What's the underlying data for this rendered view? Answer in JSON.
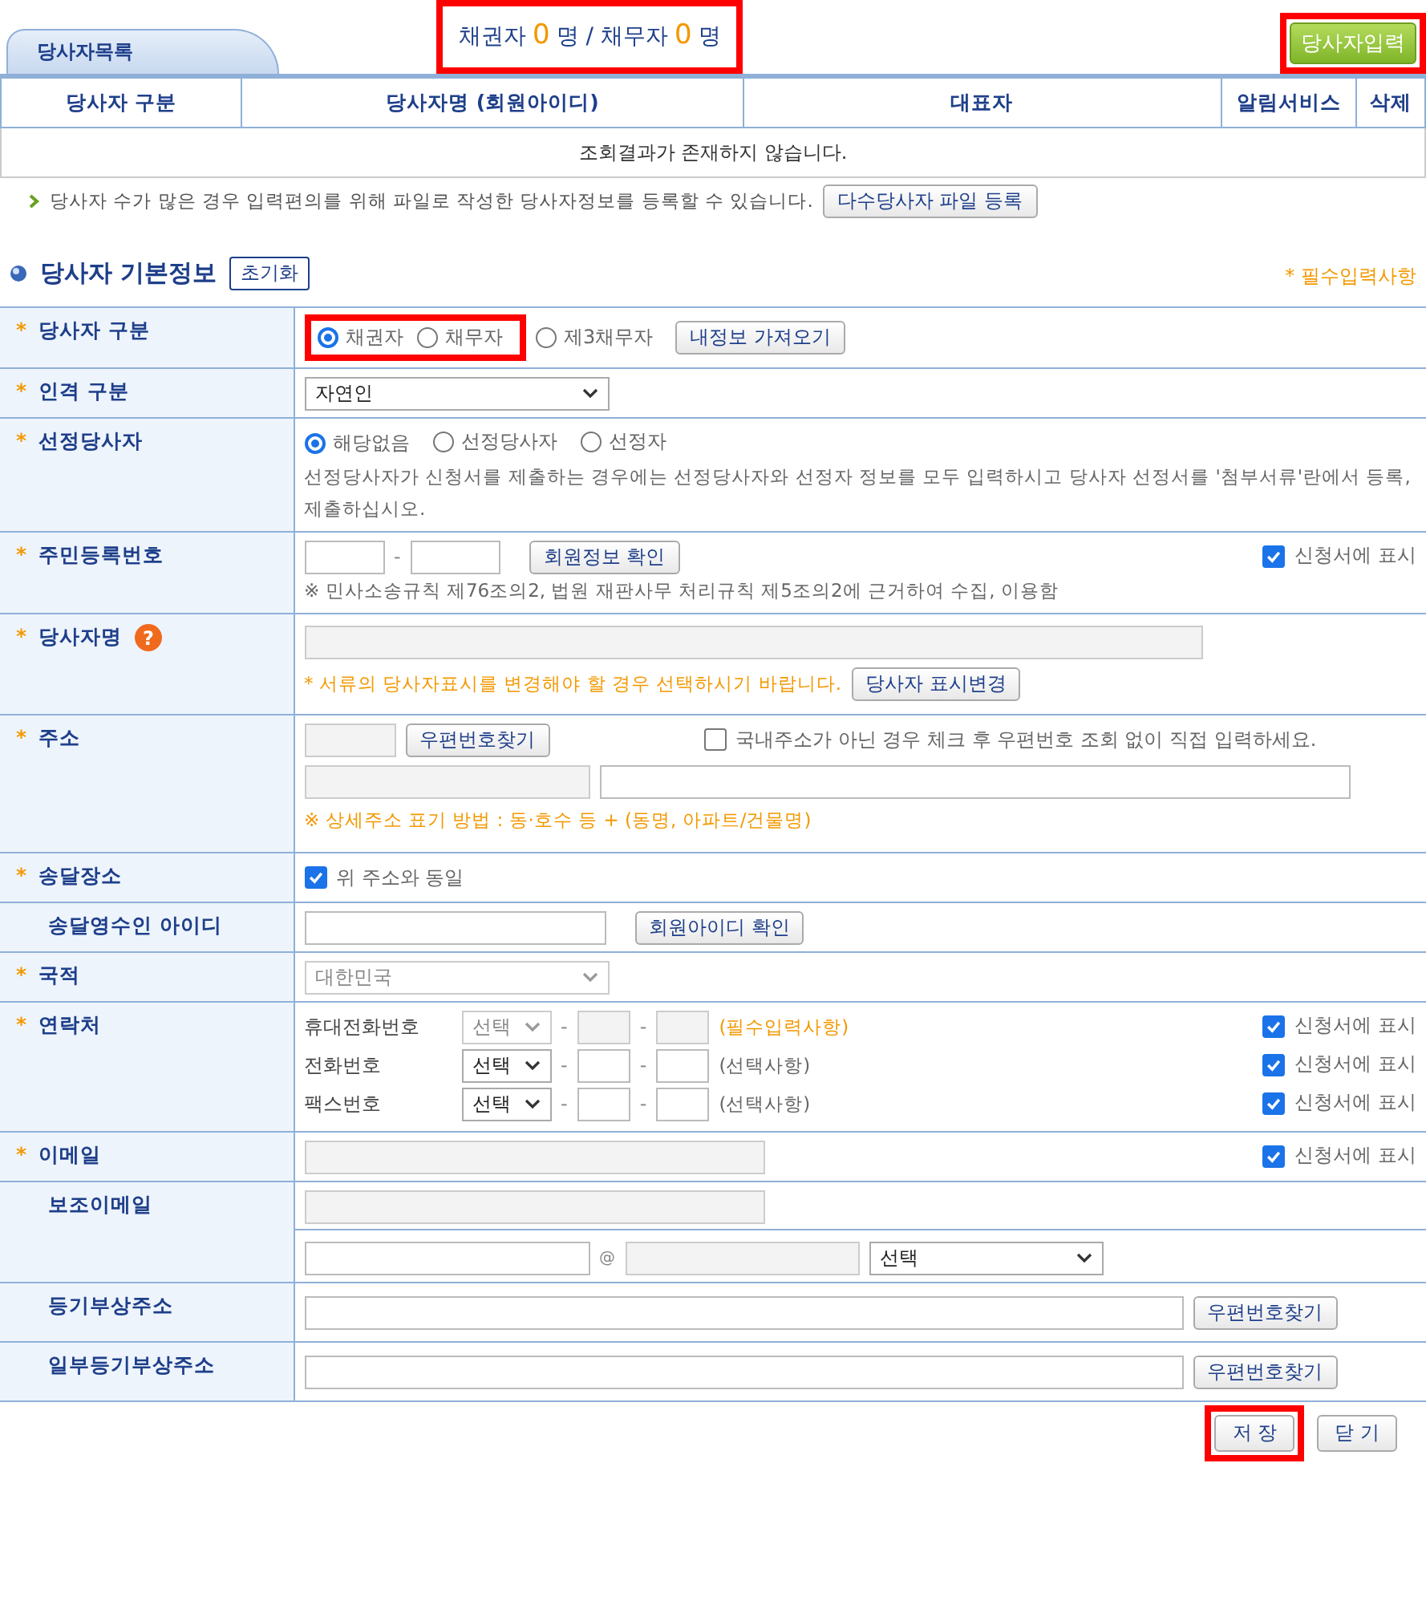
{
  "list_panel": {
    "tab": "당사자목록",
    "counter": {
      "highlighted": true,
      "creditor_label": "채권자",
      "creditor_count": "0",
      "creditor_unit": "명",
      "separator": "/",
      "debtor_label": "채무자",
      "debtor_count": "0",
      "debtor_unit": "명"
    },
    "add_button": {
      "label": "당사자입력",
      "highlighted": true
    },
    "columns": [
      "당사자 구분",
      "당사자명 (회원아이디)",
      "대표자",
      "알림서비스",
      "삭제"
    ],
    "empty_message": "조회결과가 존재하지 않습니다.",
    "bulk_note": "당사자 수가 많은 경우 입력편의를 위해 파일로 작성한 당사자정보를 등록할 수 있습니다.",
    "bulk_button": "다수당사자 파일 등록"
  },
  "section": {
    "title": "당사자 기본정보",
    "reset_button": "초기화",
    "required_note": "* 필수입력사항"
  },
  "rows": [
    {
      "kind": "radio",
      "label": "당사자 구분",
      "mark": "*",
      "options": [
        {
          "label": "채권자",
          "selected": true,
          "highlighted": true
        },
        {
          "label": "채무자",
          "selected": false,
          "highlighted": true
        },
        {
          "label": "제3채무자",
          "selected": false,
          "highlighted": false
        }
      ],
      "button": "내정보 가져오기"
    },
    {
      "kind": "select",
      "label": "인격 구분",
      "mark": "*",
      "value": "자연인",
      "disabled": false
    },
    {
      "kind": "radio",
      "label": "선정당사자",
      "mark": "*",
      "options": [
        {
          "label": "해당없음",
          "selected": true,
          "highlighted": false
        },
        {
          "label": "선정당사자",
          "selected": false,
          "highlighted": false
        },
        {
          "label": "선정자",
          "selected": false,
          "highlighted": false
        }
      ],
      "note": "선정당사자가 신청서를 제출하는 경우에는 선정당사자와 선정자 정보를 모두 입력하시고 당사자 선정서를 '첨부서류'란에서 등록, 제출하십시오."
    },
    {
      "kind": "rrn",
      "label": "주민등록번호",
      "mark": "*",
      "dash": "-",
      "button": "회원정보 확인",
      "checkbox": {
        "label": "신청서에 표시",
        "checked": true
      },
      "note": "※ 민사소송규칙 제76조의2, 법원 재판사무 처리규칙 제5조의2에 근거하여 수집, 이용함"
    },
    {
      "kind": "name",
      "label": "당사자명",
      "mark": "*",
      "help_icon": "?",
      "note": "* 서류의 당사자표시를 변경해야 할 경우 선택하시기 바랍니다.",
      "button": "당사자 표시변경"
    },
    {
      "kind": "address",
      "label": "주소",
      "mark": "*",
      "button": "우편번호찾기",
      "checkbox": {
        "label": "국내주소가 아닌 경우 체크 후 우편번호 조회 없이 직접 입력하세요.",
        "checked": false
      },
      "note": "※ 상세주소 표기 방법 : 동·호수 등 + (동명, 아파트/건물명)"
    },
    {
      "kind": "checkbox",
      "label": "송달장소",
      "mark": "*",
      "checkbox": {
        "label": "위 주소와 동일",
        "checked": true
      }
    },
    {
      "kind": "id_check",
      "label": "송달영수인 아이디",
      "button": "회원아이디 확인"
    },
    {
      "kind": "select",
      "label": "국적",
      "mark": "*",
      "value": "대한민국",
      "disabled": true
    },
    {
      "kind": "phones",
      "label": "연락처",
      "mark": "*",
      "lines": [
        {
          "label": "휴대전화번호",
          "select": "선택",
          "disabled": true,
          "dash": "-",
          "note": "(필수입력사항)",
          "mandatory": true,
          "checkbox": {
            "label": "신청서에 표시",
            "checked": true
          }
        },
        {
          "label": "전화번호",
          "select": "선택",
          "disabled": false,
          "dash": "-",
          "note": "(선택사항)",
          "mandatory": false,
          "checkbox": {
            "label": "신청서에 표시",
            "checked": true
          }
        },
        {
          "label": "팩스번호",
          "select": "선택",
          "disabled": false,
          "dash": "-",
          "note": "(선택사항)",
          "mandatory": false,
          "checkbox": {
            "label": "신청서에 표시",
            "checked": true
          }
        }
      ]
    },
    {
      "kind": "email",
      "label": "이메일",
      "mark": "*",
      "checkbox": {
        "label": "신청서에 표시",
        "checked": true
      }
    },
    {
      "kind": "sub_email",
      "label": "보조이메일",
      "at": "@",
      "select": "선택"
    },
    {
      "kind": "address_line",
      "label": "등기부상주소",
      "button": "우편번호찾기"
    },
    {
      "kind": "address_line",
      "label": "일부등기부상주소",
      "button": "우편번호찾기"
    }
  ],
  "footer_buttons": [
    {
      "label": "저 장",
      "highlighted": true
    },
    {
      "label": "닫 기",
      "highlighted": false
    }
  ]
}
